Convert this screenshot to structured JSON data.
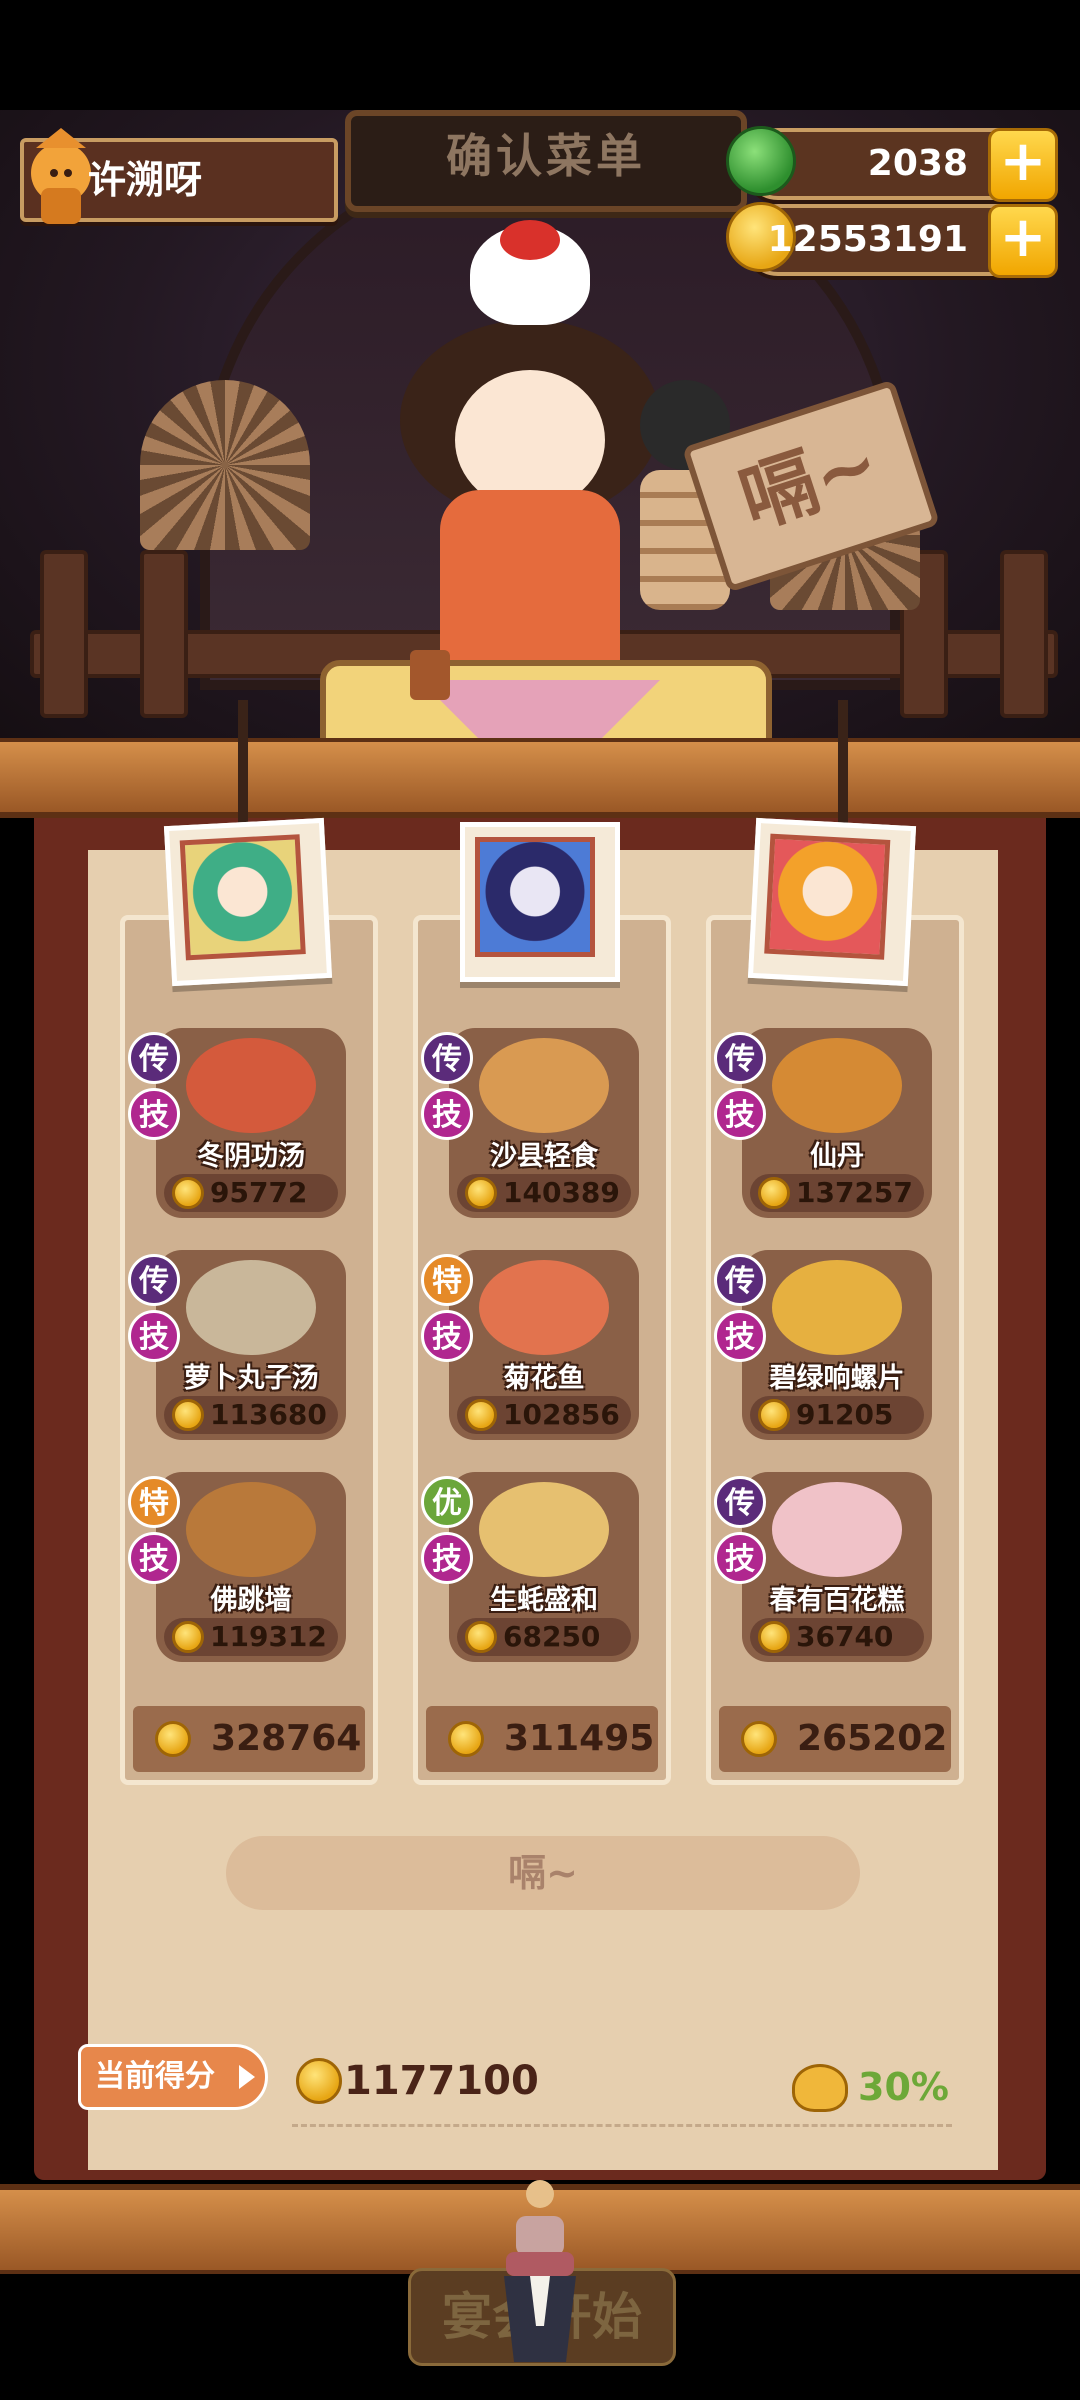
{
  "header": {
    "banner_title": "确认菜单",
    "player_name": "许溯呀",
    "jade": "2038",
    "coins": "12553191",
    "plus_symbol": "+"
  },
  "scene": {
    "sign_text": "嗝~"
  },
  "columns": [
    {
      "dishes": [
        {
          "badge_top": "传",
          "badge_top_color": "#5b2b7a",
          "badge_skill": "技",
          "name": "冬阴功汤",
          "price": "95772",
          "plate_color": "#d45a3c"
        },
        {
          "badge_top": "传",
          "badge_top_color": "#5b2b7a",
          "badge_skill": "技",
          "name": "萝卜丸子汤",
          "price": "113680",
          "plate_color": "#c9b79a"
        },
        {
          "badge_top": "特",
          "badge_top_color": "#e58a28",
          "badge_skill": "技",
          "name": "佛跳墙",
          "price": "119312",
          "plate_color": "#b9793a"
        }
      ],
      "total": "328764"
    },
    {
      "dishes": [
        {
          "badge_top": "传",
          "badge_top_color": "#5b2b7a",
          "badge_skill": "技",
          "name": "沙县轻食",
          "price": "140389",
          "plate_color": "#d99a52"
        },
        {
          "badge_top": "特",
          "badge_top_color": "#e58a28",
          "badge_skill": "技",
          "name": "菊花鱼",
          "price": "102856",
          "plate_color": "#e2734e"
        },
        {
          "badge_top": "优",
          "badge_top_color": "#6ba63a",
          "badge_skill": "技",
          "name": "生蚝盛和",
          "price": "68250",
          "plate_color": "#e6c070"
        }
      ],
      "total": "311495"
    },
    {
      "dishes": [
        {
          "badge_top": "传",
          "badge_top_color": "#5b2b7a",
          "badge_skill": "技",
          "name": "仙丹",
          "price": "137257",
          "plate_color": "#d58a34"
        },
        {
          "badge_top": "传",
          "badge_top_color": "#5b2b7a",
          "badge_skill": "技",
          "name": "碧绿响螺片",
          "price": "91205",
          "plate_color": "#e6b040"
        },
        {
          "badge_top": "传",
          "badge_top_color": "#5b2b7a",
          "badge_skill": "技",
          "name": "春有百花糕",
          "price": "36740",
          "plate_color": "#f0c2c8"
        }
      ],
      "total": "265202"
    }
  ],
  "actions": {
    "hum_button": "嗝~",
    "start_button": "宴会开始"
  },
  "score": {
    "label": "当前得分",
    "value": "1177100",
    "bonus": "30%"
  },
  "colors": {
    "skill_badge": "#b0278f",
    "coin_gold": "#f2b81e",
    "jade_green": "#3aa33a"
  }
}
